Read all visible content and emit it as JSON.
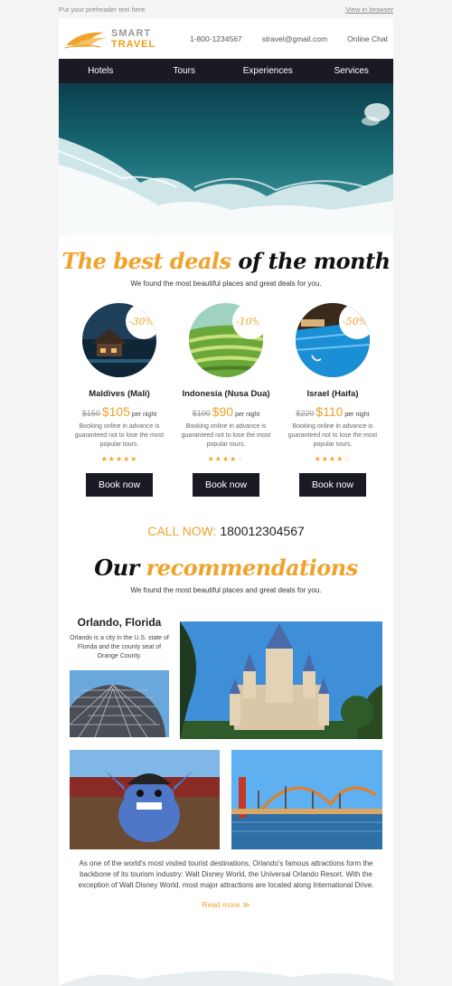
{
  "preheader": {
    "text": "Put your preheader text here",
    "view_link": "View in browser"
  },
  "logo": {
    "line1": "SMART",
    "line2": "TRAVEL"
  },
  "header": {
    "phone": "1-800-1234567",
    "email": "stravel@gmail.com",
    "chat": "Online Chat"
  },
  "nav": [
    "Hotels",
    "Tours",
    "Experiences",
    "Services"
  ],
  "deals_section": {
    "title_orange": "The best deals",
    "title_dark": "of the month",
    "subtitle": "We found the most beautiful places and great deals for you."
  },
  "deals": [
    {
      "discount": "-30%",
      "name": "Maldives (Mali)",
      "old_price": "$150",
      "new_price": "$105",
      "per": "per night",
      "desc": "Booking online in advance is guaranteed not to lose the most popular tours.",
      "rating": 5,
      "stars": "★★★★★",
      "stars_empty": "",
      "button": "Book now"
    },
    {
      "discount": "-10%",
      "name": "Indonesia (Nusa Dua)",
      "old_price": "$100",
      "new_price": "$90",
      "per": "per night",
      "desc": "Booking online in advance is guaranteed not to lose the most popular tours.",
      "rating": 4,
      "stars": "★★★★",
      "stars_empty": "☆",
      "button": "Book now"
    },
    {
      "discount": "-50%",
      "name": "Israel (Haifa)",
      "old_price": "$220",
      "new_price": "$110",
      "per": "per night",
      "desc": "Booking online in advance is guaranteed not to lose the most popular tours.",
      "rating": 4,
      "stars": "★★★★",
      "stars_empty": "☆",
      "button": "Book now"
    }
  ],
  "call": {
    "label": "CALL NOW:",
    "number": "180012304567"
  },
  "rec_section": {
    "title_dark": "Our",
    "title_orange": "recommendations",
    "subtitle": "We found the most beautiful places and great deals for you."
  },
  "orlando": {
    "title": "Orlando, Florida",
    "desc": "Orlando is a city in the U.S. state of Florida and the county seat of Orange County.",
    "text": "As one of the world's most visited tourist destinations, Orlando's famous attractions form the backbone of its tourism industry: Walt Disney World, the Universal Orlando Resort. With the exception of Walt Disney World, most major attractions are located along International Drive.",
    "read_more": "Read more  ≫"
  },
  "colors": {
    "accent": "#f0a22a",
    "dark": "#1a1a24"
  }
}
